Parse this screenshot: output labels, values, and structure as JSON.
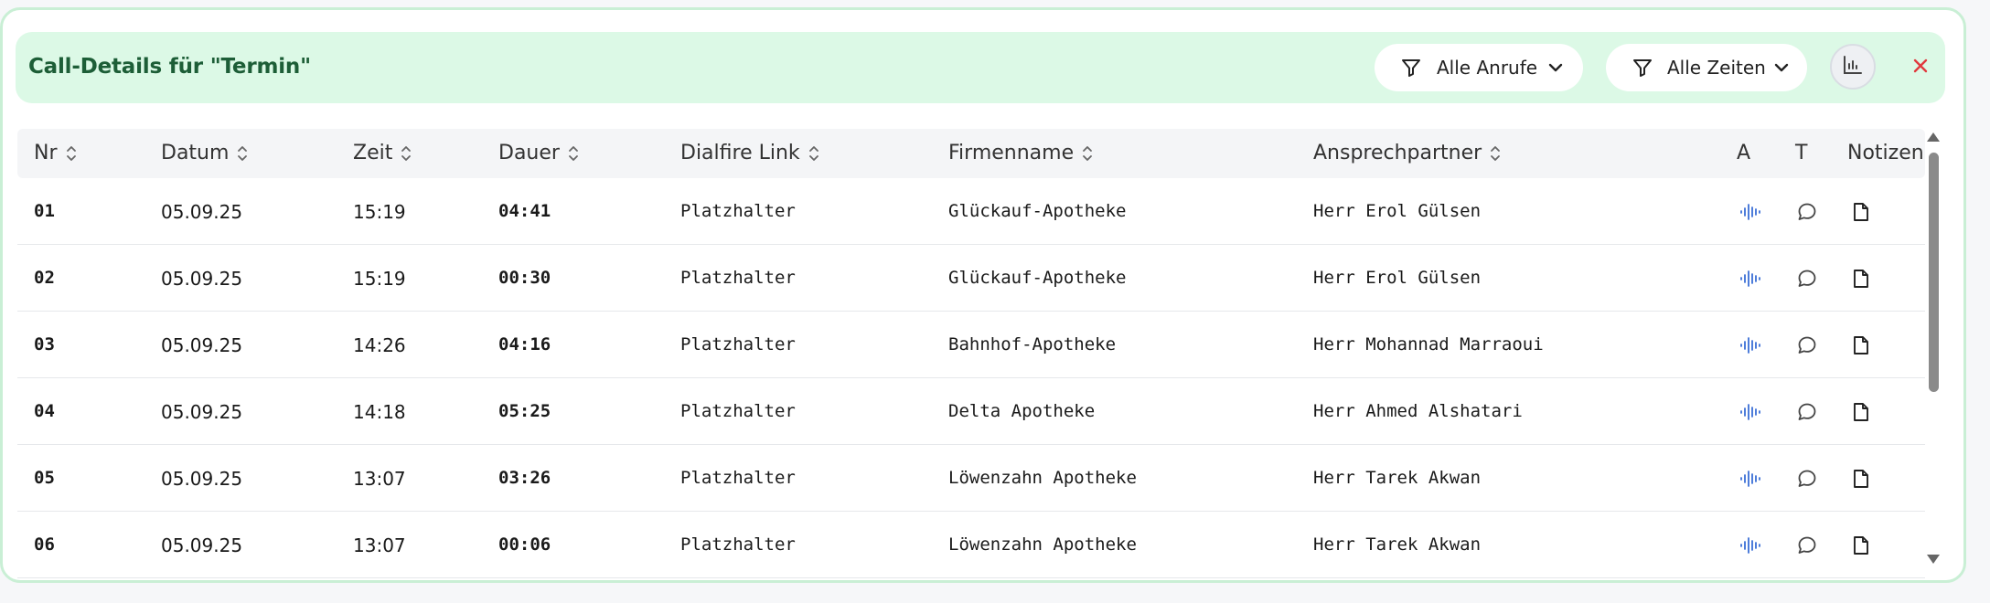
{
  "panel": {
    "title": "Call-Details für \"Termin\"",
    "filter_calls": "Alle Anrufe",
    "filter_times": "Alle Zeiten",
    "stats_icon": "bar-chart-icon",
    "close_icon": "close-icon"
  },
  "colors": {
    "header_bg": "#dcf9e6",
    "title": "#1d5e37",
    "close": "#e0393e",
    "audio": "#3b6fd6"
  },
  "table": {
    "columns": [
      "Nr",
      "Datum",
      "Zeit",
      "Dauer",
      "Dialfire Link",
      "Firmenname",
      "Ansprechpartner",
      "A",
      "T",
      "Notizen"
    ],
    "rows": [
      {
        "nr": "01",
        "datum": "05.09.25",
        "zeit": "15:19",
        "dauer": "04:41",
        "link": "Platzhalter",
        "firma": "Glückauf-Apotheke",
        "ansprech": "Herr Erol Gülsen"
      },
      {
        "nr": "02",
        "datum": "05.09.25",
        "zeit": "15:19",
        "dauer": "00:30",
        "link": "Platzhalter",
        "firma": "Glückauf-Apotheke",
        "ansprech": "Herr Erol Gülsen"
      },
      {
        "nr": "03",
        "datum": "05.09.25",
        "zeit": "14:26",
        "dauer": "04:16",
        "link": "Platzhalter",
        "firma": "Bahnhof-Apotheke",
        "ansprech": "Herr Mohannad Marraoui"
      },
      {
        "nr": "04",
        "datum": "05.09.25",
        "zeit": "14:18",
        "dauer": "05:25",
        "link": "Platzhalter",
        "firma": "Delta Apotheke",
        "ansprech": "Herr Ahmed Alshatari"
      },
      {
        "nr": "05",
        "datum": "05.09.25",
        "zeit": "13:07",
        "dauer": "03:26",
        "link": "Platzhalter",
        "firma": "Löwenzahn Apotheke",
        "ansprech": "Herr Tarek Akwan"
      },
      {
        "nr": "06",
        "datum": "05.09.25",
        "zeit": "13:07",
        "dauer": "00:06",
        "link": "Platzhalter",
        "firma": "Löwenzahn Apotheke",
        "ansprech": "Herr Tarek Akwan"
      }
    ]
  }
}
